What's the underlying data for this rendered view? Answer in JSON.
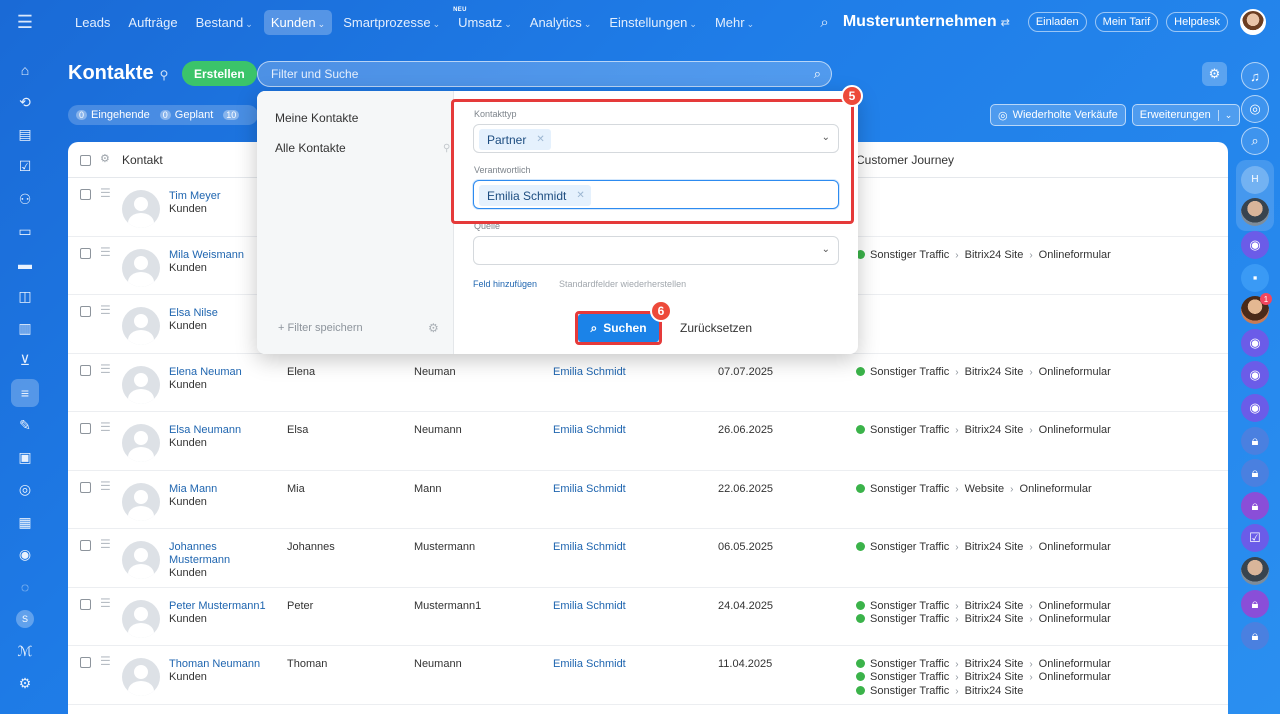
{
  "topnav": {
    "items": [
      {
        "label": "Leads",
        "chev": false,
        "new": ""
      },
      {
        "label": "Aufträge",
        "chev": false,
        "new": ""
      },
      {
        "label": "Bestand",
        "chev": true,
        "new": ""
      },
      {
        "label": "Kunden",
        "chev": true,
        "new": "",
        "active": true
      },
      {
        "label": "Smartprozesse",
        "chev": true,
        "new": ""
      },
      {
        "label": "Umsatz",
        "chev": true,
        "new": "NEU"
      },
      {
        "label": "Analytics",
        "chev": true,
        "new": ""
      },
      {
        "label": "Einstellungen",
        "chev": true,
        "new": ""
      },
      {
        "label": "Mehr",
        "chev": true,
        "new": ""
      }
    ]
  },
  "header": {
    "company": "Musterunternehmen",
    "invite": "Einladen",
    "tariff": "Mein Tarif",
    "helpdesk": "Helpdesk"
  },
  "page": {
    "title": "Kontakte",
    "create": "Erstellen",
    "search_placeholder": "Filter und Suche"
  },
  "counters": [
    {
      "num": "0",
      "label": "Eingehende"
    },
    {
      "num": "0",
      "label": "Geplant"
    },
    {
      "num": "10",
      "label": ""
    }
  ],
  "actions": {
    "repeat_sales": "Wiederholte Verkäufe",
    "extensions": "Erweiterungen"
  },
  "grid": {
    "header_contact": "Kontakt",
    "header_journey": "Customer Journey",
    "rows": [
      {
        "name": "Tim Meyer",
        "type": "Kunden",
        "first": "",
        "last": "",
        "resp": "",
        "date": "",
        "journey": []
      },
      {
        "name": "Mila Weismann",
        "type": "Kunden",
        "first": "",
        "last": "",
        "resp": "",
        "date": "",
        "journey": [
          [
            "Sonstiger Traffic",
            "Bitrix24 Site",
            "Onlineformular"
          ]
        ]
      },
      {
        "name": "Elsa Nilse",
        "type": "Kunden",
        "first": "",
        "last": "",
        "resp": "",
        "date": "",
        "journey": []
      },
      {
        "name": "Elena Neuman",
        "type": "Kunden",
        "first": "Elena",
        "last": "Neuman",
        "resp": "Emilia Schmidt",
        "date": "07.07.2025",
        "journey": [
          [
            "Sonstiger Traffic",
            "Bitrix24 Site",
            "Onlineformular"
          ]
        ]
      },
      {
        "name": "Elsa Neumann",
        "type": "Kunden",
        "first": "Elsa",
        "last": "Neumann",
        "resp": "Emilia Schmidt",
        "date": "26.06.2025",
        "journey": [
          [
            "Sonstiger Traffic",
            "Bitrix24 Site",
            "Onlineformular"
          ]
        ]
      },
      {
        "name": "Mia Mann",
        "type": "Kunden",
        "first": "Mia",
        "last": "Mann",
        "resp": "Emilia Schmidt",
        "date": "22.06.2025",
        "journey": [
          [
            "Sonstiger Traffic",
            "Website",
            "Onlineformular"
          ]
        ]
      },
      {
        "name": "Johannes Mustermann",
        "type": "Kunden",
        "first": "Johannes",
        "last": "Mustermann",
        "resp": "Emilia Schmidt",
        "date": "06.05.2025",
        "journey": [
          [
            "Sonstiger Traffic",
            "Bitrix24 Site",
            "Onlineformular"
          ]
        ]
      },
      {
        "name": "Peter Mustermann1",
        "type": "Kunden",
        "first": "Peter",
        "last": "Mustermann1",
        "resp": "Emilia Schmidt",
        "date": "24.04.2025",
        "journey": [
          [
            "Sonstiger Traffic",
            "Bitrix24 Site",
            "Onlineformular"
          ],
          [
            "Sonstiger Traffic",
            "Bitrix24 Site",
            "Onlineformular"
          ]
        ]
      },
      {
        "name": "Thoman Neumann",
        "type": "Kunden",
        "first": "Thoman",
        "last": "Neumann",
        "resp": "Emilia Schmidt",
        "date": "11.04.2025",
        "journey": [
          [
            "Sonstiger Traffic",
            "Bitrix24 Site",
            "Onlineformular"
          ],
          [
            "Sonstiger Traffic",
            "Bitrix24 Site",
            "Onlineformular"
          ],
          [
            "Sonstiger Traffic",
            "Bitrix24 Site",
            ""
          ]
        ]
      }
    ]
  },
  "filter": {
    "presets": [
      "Meine Kontakte",
      "Alle Kontakte"
    ],
    "save_filter": "+ Filter speichern",
    "fields": {
      "contact_type_label": "Kontakttyp",
      "contact_type_value": "Partner",
      "responsible_label": "Verantwortlich",
      "responsible_value": "Emilia Schmidt",
      "source_label": "Quelle"
    },
    "add_field": "Feld hinzufügen",
    "restore": "Standardfelder wiederherstellen",
    "search_button": "Suchen",
    "reset_button": "Zurücksetzen"
  },
  "steps": {
    "step5": "5",
    "step6": "6"
  },
  "leftbar_icons": [
    "home-icon",
    "inbox-icon",
    "document-icon",
    "tasks-icon",
    "contacts-icon",
    "docs-icon",
    "inventory-icon",
    "presentation-icon",
    "analytics-icon",
    "shop-icon",
    "crm-filter-icon",
    "signature-icon",
    "id-card-icon",
    "support-icon",
    "calendar-icon",
    "robot-icon",
    "target-icon",
    "s-icon",
    "sites-icon",
    "settings-icon"
  ],
  "colors": {
    "accent": "#1b83e8",
    "create": "#3bc46a",
    "highlight": "#e53a3a"
  }
}
